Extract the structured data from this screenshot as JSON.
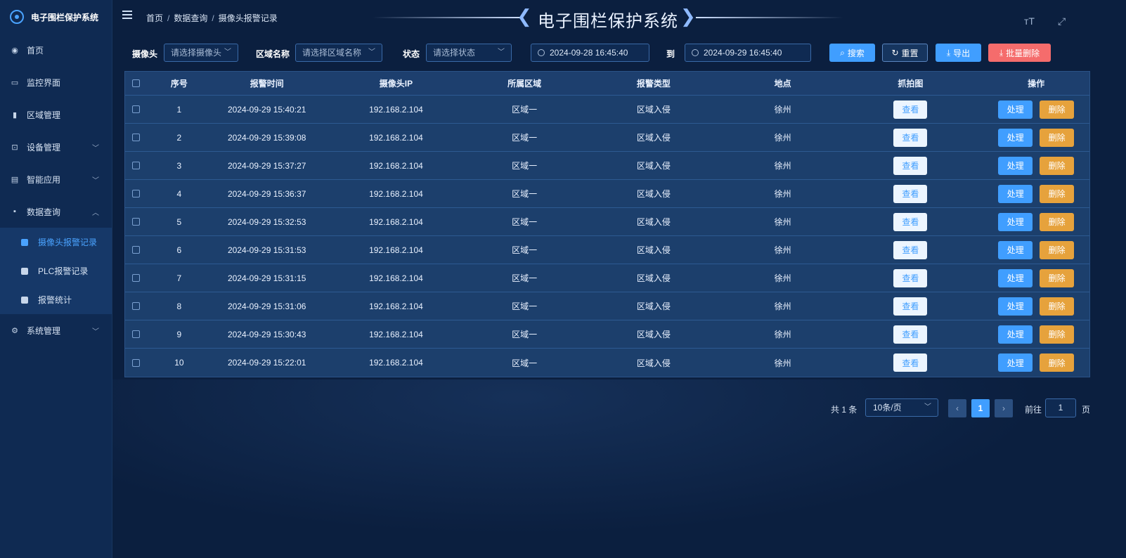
{
  "app": {
    "title": "电子围栏保护系统",
    "header_title": "电子围栏保护系统"
  },
  "sidebar": {
    "items": [
      {
        "label": "首页"
      },
      {
        "label": "监控界面"
      },
      {
        "label": "区域管理"
      },
      {
        "label": "设备管理"
      },
      {
        "label": "智能应用"
      },
      {
        "label": "数据查询"
      },
      {
        "label": "系统管理"
      }
    ],
    "sub_items": [
      {
        "label": "摄像头报警记录"
      },
      {
        "label": "PLC报警记录"
      },
      {
        "label": "报警统计"
      }
    ]
  },
  "breadcrumb": {
    "home": "首页",
    "sep": "/",
    "level1": "数据查询",
    "current": "摄像头报警记录"
  },
  "filters": {
    "camera_label": "摄像头",
    "camera_placeholder": "请选择摄像头",
    "area_label": "区域名称",
    "area_placeholder": "请选择区域名称",
    "status_label": "状态",
    "status_placeholder": "请选择状态",
    "start_date": "2024-09-28 16:45:40",
    "to_label": "到",
    "end_date": "2024-09-29 16:45:40",
    "search_label": "搜索",
    "reset_label": "重置",
    "export_label": "导出",
    "batch_delete_label": "批量删除"
  },
  "table": {
    "headers": {
      "no": "序号",
      "time": "报警时间",
      "ip": "摄像头IP",
      "area": "所属区域",
      "type": "报警类型",
      "location": "地点",
      "snapshot": "抓拍图",
      "operation": "操作"
    },
    "view_label": "查看",
    "handle_label": "处理",
    "delete_label": "删除",
    "rows": [
      {
        "no": "1",
        "time": "2024-09-29 15:40:21",
        "ip": "192.168.2.104",
        "area": "区域一",
        "type": "区域入侵",
        "location": "徐州"
      },
      {
        "no": "2",
        "time": "2024-09-29 15:39:08",
        "ip": "192.168.2.104",
        "area": "区域一",
        "type": "区域入侵",
        "location": "徐州"
      },
      {
        "no": "3",
        "time": "2024-09-29 15:37:27",
        "ip": "192.168.2.104",
        "area": "区域一",
        "type": "区域入侵",
        "location": "徐州"
      },
      {
        "no": "4",
        "time": "2024-09-29 15:36:37",
        "ip": "192.168.2.104",
        "area": "区域一",
        "type": "区域入侵",
        "location": "徐州"
      },
      {
        "no": "5",
        "time": "2024-09-29 15:32:53",
        "ip": "192.168.2.104",
        "area": "区域一",
        "type": "区域入侵",
        "location": "徐州"
      },
      {
        "no": "6",
        "time": "2024-09-29 15:31:53",
        "ip": "192.168.2.104",
        "area": "区域一",
        "type": "区域入侵",
        "location": "徐州"
      },
      {
        "no": "7",
        "time": "2024-09-29 15:31:15",
        "ip": "192.168.2.104",
        "area": "区域一",
        "type": "区域入侵",
        "location": "徐州"
      },
      {
        "no": "8",
        "time": "2024-09-29 15:31:06",
        "ip": "192.168.2.104",
        "area": "区域一",
        "type": "区域入侵",
        "location": "徐州"
      },
      {
        "no": "9",
        "time": "2024-09-29 15:30:43",
        "ip": "192.168.2.104",
        "area": "区域一",
        "type": "区域入侵",
        "location": "徐州"
      },
      {
        "no": "10",
        "time": "2024-09-29 15:22:01",
        "ip": "192.168.2.104",
        "area": "区域一",
        "type": "区域入侵",
        "location": "徐州"
      }
    ]
  },
  "pagination": {
    "total_text": "共 1 条",
    "page_size": "10条/页",
    "current_page": "1",
    "goto_label": "前往",
    "goto_value": "1",
    "page_unit": "页"
  },
  "colors": {
    "primary": "#409eff",
    "danger": "#f56c6c",
    "warning": "#e6a23c",
    "background": "#0b1f3f"
  }
}
